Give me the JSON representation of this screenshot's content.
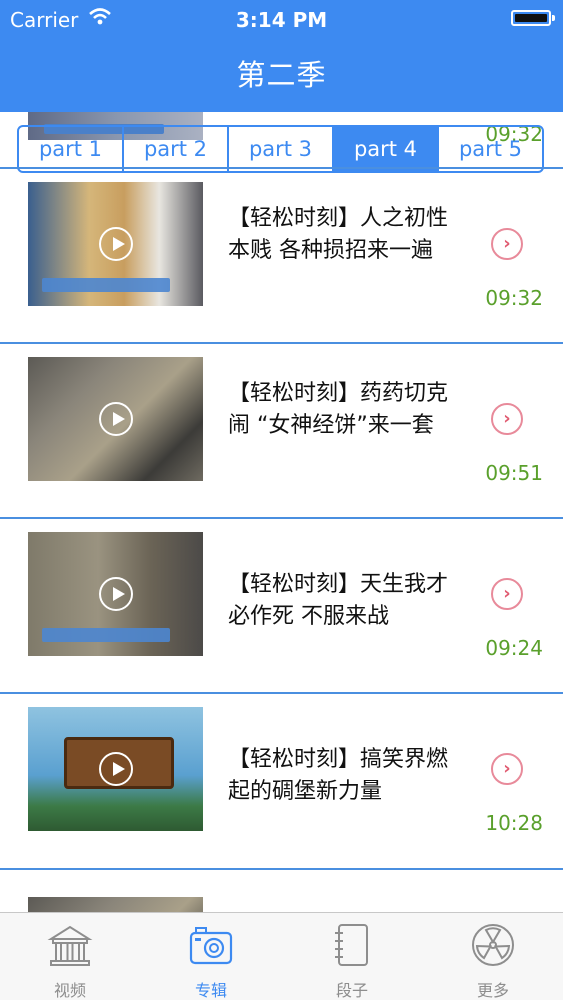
{
  "status_bar": {
    "carrier": "Carrier",
    "time": "3:14 PM"
  },
  "nav": {
    "title": "第二季"
  },
  "peek_item": {
    "duration": "09:32"
  },
  "segments": [
    {
      "label": "part 1",
      "active": false
    },
    {
      "label": "part 2",
      "active": false
    },
    {
      "label": "part 3",
      "active": false
    },
    {
      "label": "part 4",
      "active": true
    },
    {
      "label": "part 5",
      "active": false
    }
  ],
  "items": [
    {
      "title": "【轻松时刻】人之初性本贱 各种损招来一遍",
      "duration": "09:32"
    },
    {
      "title": "【轻松时刻】药药切克闹 “女神经饼”来一套",
      "duration": "09:51"
    },
    {
      "title": "【轻松时刻】天生我才必作死 不服来战",
      "duration": "09:24"
    },
    {
      "title": "【轻松时刻】搞笑界燃起的碉堡新力量",
      "duration": "10:28"
    }
  ],
  "tabbar": [
    {
      "label": "视频",
      "icon": "building-icon"
    },
    {
      "label": "专辑",
      "icon": "camera-icon",
      "active": true
    },
    {
      "label": "段子",
      "icon": "notebook-icon"
    },
    {
      "label": "更多",
      "icon": "film-reel-icon"
    }
  ],
  "colors": {
    "accent": "#3d8af1",
    "duration_green": "#5aa02c",
    "chevron_red": "#e05a70"
  }
}
